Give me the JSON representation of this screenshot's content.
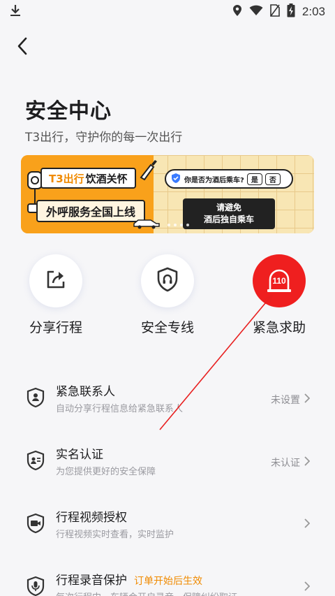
{
  "status_bar": {
    "time": "2:03"
  },
  "header": {
    "title": "安全中心",
    "subtitle": "T3出行，守护你的每一次出行"
  },
  "banner": {
    "brand": "T3出行",
    "tag1_rest": "饮酒关怀",
    "tag2": "外呼服务全国上线",
    "question": "你是否为酒后乘车?",
    "yes": "是",
    "no": "否",
    "warn_line1": "请避免",
    "warn_line2": "酒后独自乘车"
  },
  "quick_actions": [
    {
      "label": "分享行程",
      "icon": "share-icon"
    },
    {
      "label": "安全专线",
      "icon": "shield-phone-icon"
    },
    {
      "label": "紧急求助",
      "icon": "alarm-110-icon",
      "badge": "110",
      "color": "#ef1f1f"
    }
  ],
  "list": [
    {
      "title": "紧急联系人",
      "subtitle": "自动分享行程信息给紧急联系人",
      "status": "未设置",
      "icon": "contact-shield-icon"
    },
    {
      "title": "实名认证",
      "subtitle": "为您提供更好的安全保障",
      "status": "未认证",
      "icon": "id-card-icon"
    },
    {
      "title": "行程视频授权",
      "subtitle": "行程视频实时查看，实时监护",
      "status": "",
      "icon": "video-camera-icon"
    },
    {
      "title": "行程录音保护",
      "tag": "订单开始后生效",
      "subtitle": "每次行程中，车辆会开启录音，保障纠纷取证",
      "status": "",
      "icon": "microphone-icon"
    }
  ],
  "colors": {
    "accent_red": "#ef1f1f",
    "accent_orange": "#f08a00",
    "banner_orange": "#f9a11b"
  }
}
